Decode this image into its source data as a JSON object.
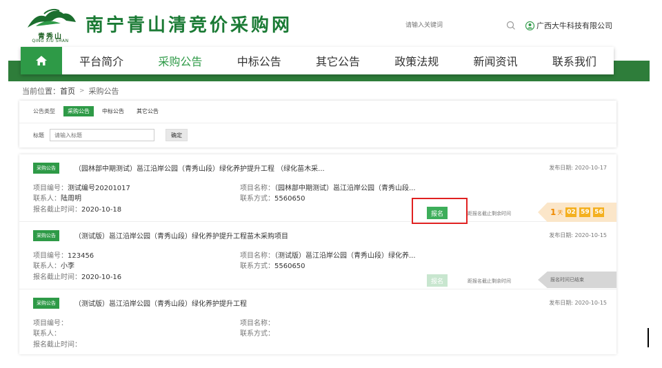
{
  "header": {
    "logo_cn": "青秀山",
    "logo_en": "QING XIU SHAN",
    "site_title": "南宁青山清竞价采购网",
    "search_placeholder": "请输入关键词",
    "search_icon": "search-icon",
    "user_icon": "user-circle-icon",
    "user_name": "广西大牛科技有限公司"
  },
  "nav": {
    "home_icon": "home-icon",
    "items": [
      "平台简介",
      "采购公告",
      "中标公告",
      "其它公告",
      "政策法规",
      "新闻资讯",
      "联系我们"
    ],
    "active": "采购公告"
  },
  "breadcrumb": {
    "prefix": "当前位置：",
    "home": "首页",
    "current": "采购公告"
  },
  "filter": {
    "type_label": "公告类型",
    "tabs": [
      "采购公告",
      "中标公告",
      "其它公告"
    ],
    "active_tab": "采购公告",
    "title_label": "标题",
    "title_placeholder": "请输入标题",
    "confirm_label": "确定"
  },
  "list": {
    "signup_label": "报名",
    "deadline_remaining_label": "距报名截止剩余时间",
    "ended_label": "报名时间已结束",
    "labels": {
      "project_no": "项目编号：",
      "project_name": "项目名称：",
      "contact": "联系人：",
      "contact_method": "联系方式：",
      "deadline": "报名截止时间："
    },
    "items": [
      {
        "tag": "采购公告",
        "title": "（园林部中期测试）邕江沿岸公园（青秀山段）绿化养护提升工程 （绿化苗木采...",
        "date": "发布日期: 2020-10-17",
        "project_no": "测试编号20201017",
        "project_name": "（园林部中期测试）邕江沿岸公园（青秀山段...",
        "contact": "陆周明",
        "contact_method": "5560650",
        "deadline": "2020-10-18",
        "countdown": {
          "days": "1",
          "day_unit": "天",
          "hours": "02",
          "minutes": "59",
          "seconds": "56"
        }
      },
      {
        "tag": "采购公告",
        "title": "（测试版）邕江沿岸公园（青秀山段）绿化养护提升工程苗木采购项目",
        "date": "发布日期: 2020-10-15",
        "project_no": "123456",
        "project_name": "（测试版）邕江沿岸公园（青秀山段）绿化养...",
        "contact": "小李",
        "contact_method": "5560650",
        "deadline": "2020-10-16"
      },
      {
        "tag": "采购公告",
        "title": "（测试版）邕江沿岸公园（青秀山段）绿化养护提升工程",
        "date": "发布日期: 2020-10-15",
        "project_no": "",
        "project_name": "",
        "contact": "",
        "contact_method": "",
        "deadline": ""
      }
    ]
  },
  "colors": {
    "brand_green": "#2e9a47",
    "band_green": "#2e7d3a",
    "highlight_red": "#e02020",
    "countdown_orange": "#f4b020"
  }
}
